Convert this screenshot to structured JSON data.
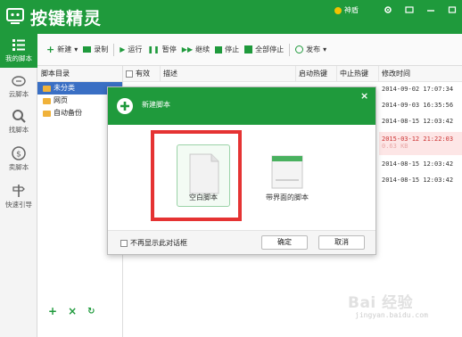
{
  "app": {
    "title": "按键精灵",
    "user_label": "神盾",
    "brand_color": "#1f9a3c"
  },
  "nav": [
    {
      "label": "我的脚本",
      "icon": "list-icon",
      "active": true
    },
    {
      "label": "云脚本",
      "icon": "cloud-icon",
      "active": false
    },
    {
      "label": "找脚本",
      "icon": "search-icon",
      "active": false
    },
    {
      "label": "卖脚本",
      "icon": "dollar-icon",
      "active": false
    },
    {
      "label": "快速引导",
      "icon": "signpost-icon",
      "active": false
    }
  ],
  "toolbar": {
    "new": "新建",
    "record": "录制",
    "run": "运行",
    "pause": "暂停",
    "resume": "继续",
    "stop": "停止",
    "stop_all": "全部停止",
    "publish": "发布"
  },
  "tree": {
    "header": "脚本目录",
    "items": [
      {
        "label": "未分类",
        "selected": true
      },
      {
        "label": "网页",
        "selected": false
      },
      {
        "label": "自动备份",
        "selected": false
      }
    ]
  },
  "table": {
    "columns": {
      "valid": "有效",
      "desc": "描述",
      "start_hotkey": "启动热键",
      "stop_hotkey": "中止热键",
      "modified": "修改时间"
    },
    "times": [
      "2014-09-02 17:07:34",
      "2014-09-03 16:35:56",
      "2014-08-15 12:03:42",
      "2015-03-12 21:22:03",
      "2014-08-15 12:03:42",
      "2014-08-15 12:03:42"
    ],
    "highlight_sub": "0.63 KB"
  },
  "dialog": {
    "title": "新建脚本",
    "option_blank": "空白脚本",
    "option_ui": "带界面的脚本",
    "dont_show": "不再显示此对话框",
    "ok": "确定",
    "cancel": "取消"
  },
  "watermark": {
    "main": "Bai 经验",
    "sub": "jingyan.baidu.com"
  }
}
